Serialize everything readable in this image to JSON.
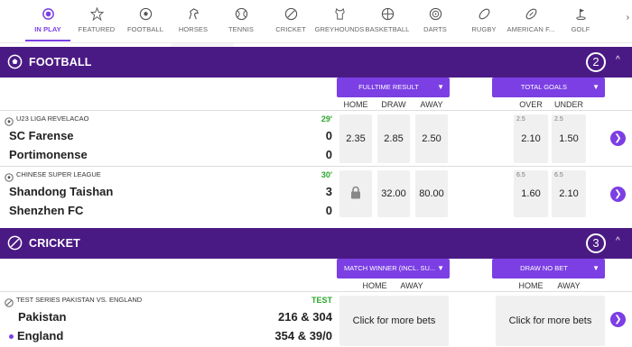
{
  "nav": {
    "items": [
      {
        "label": "IN PLAY",
        "icon": "live-icon"
      },
      {
        "label": "FEATURED",
        "icon": "star-icon"
      },
      {
        "label": "FOOTBALL",
        "icon": "football-icon"
      },
      {
        "label": "HORSES",
        "icon": "horse-icon"
      },
      {
        "label": "TENNIS",
        "icon": "tennis-icon"
      },
      {
        "label": "CRICKET",
        "icon": "cricket-icon"
      },
      {
        "label": "GREYHOUNDS",
        "icon": "greyhound-icon"
      },
      {
        "label": "BASKETBALL",
        "icon": "basketball-icon"
      },
      {
        "label": "DARTS",
        "icon": "darts-icon"
      },
      {
        "label": "RUGBY",
        "icon": "rugby-icon"
      },
      {
        "label": "AMERICAN F...",
        "icon": "american-football-icon"
      },
      {
        "label": "GOLF",
        "icon": "golf-icon"
      }
    ],
    "next_arrow": "›"
  },
  "football": {
    "title": "FOOTBALL",
    "count": "2",
    "chevron": "^",
    "market1": {
      "label": "FULLTIME RESULT",
      "cols": [
        "HOME",
        "DRAW",
        "AWAY"
      ]
    },
    "market2": {
      "label": "TOTAL GOALS",
      "cols": [
        "OVER",
        "UNDER"
      ]
    },
    "events": [
      {
        "league": "U23 LIGA REVELACAO",
        "minute": "29'",
        "home": "SC Farense",
        "away": "Portimonense",
        "home_score": "0",
        "away_score": "0",
        "odds": [
          "2.35",
          "2.85",
          "2.50"
        ],
        "goals_line": [
          "2.5",
          "2.5"
        ],
        "goals": [
          "2.10",
          "1.50"
        ]
      },
      {
        "league": "CHINESE SUPER LEAGUE",
        "minute": "30'",
        "home": "Shandong Taishan",
        "away": "Shenzhen FC",
        "home_score": "3",
        "away_score": "0",
        "odds": [
          "",
          "32.00",
          "80.00"
        ],
        "goals_line": [
          "6.5",
          "6.5"
        ],
        "goals": [
          "1.60",
          "2.10"
        ]
      }
    ]
  },
  "cricket": {
    "title": "CRICKET",
    "count": "3",
    "chevron": "^",
    "market1": {
      "label": "MATCH WINNER (INCL. SU...",
      "cols": [
        "HOME",
        "AWAY"
      ]
    },
    "market2": {
      "label": "DRAW NO BET",
      "cols": [
        "HOME",
        "AWAY"
      ]
    },
    "event": {
      "league": "TEST SERIES PAKISTAN VS. ENGLAND",
      "status": "TEST",
      "home": "Pakistan",
      "away": "England",
      "home_score": "216 & 304",
      "away_score": "354 & 39/0",
      "more_bets": "Click for more bets"
    }
  },
  "colors": {
    "brand": "#4a1a84",
    "accent": "#7b3fe4",
    "live": "#2aa52a"
  }
}
